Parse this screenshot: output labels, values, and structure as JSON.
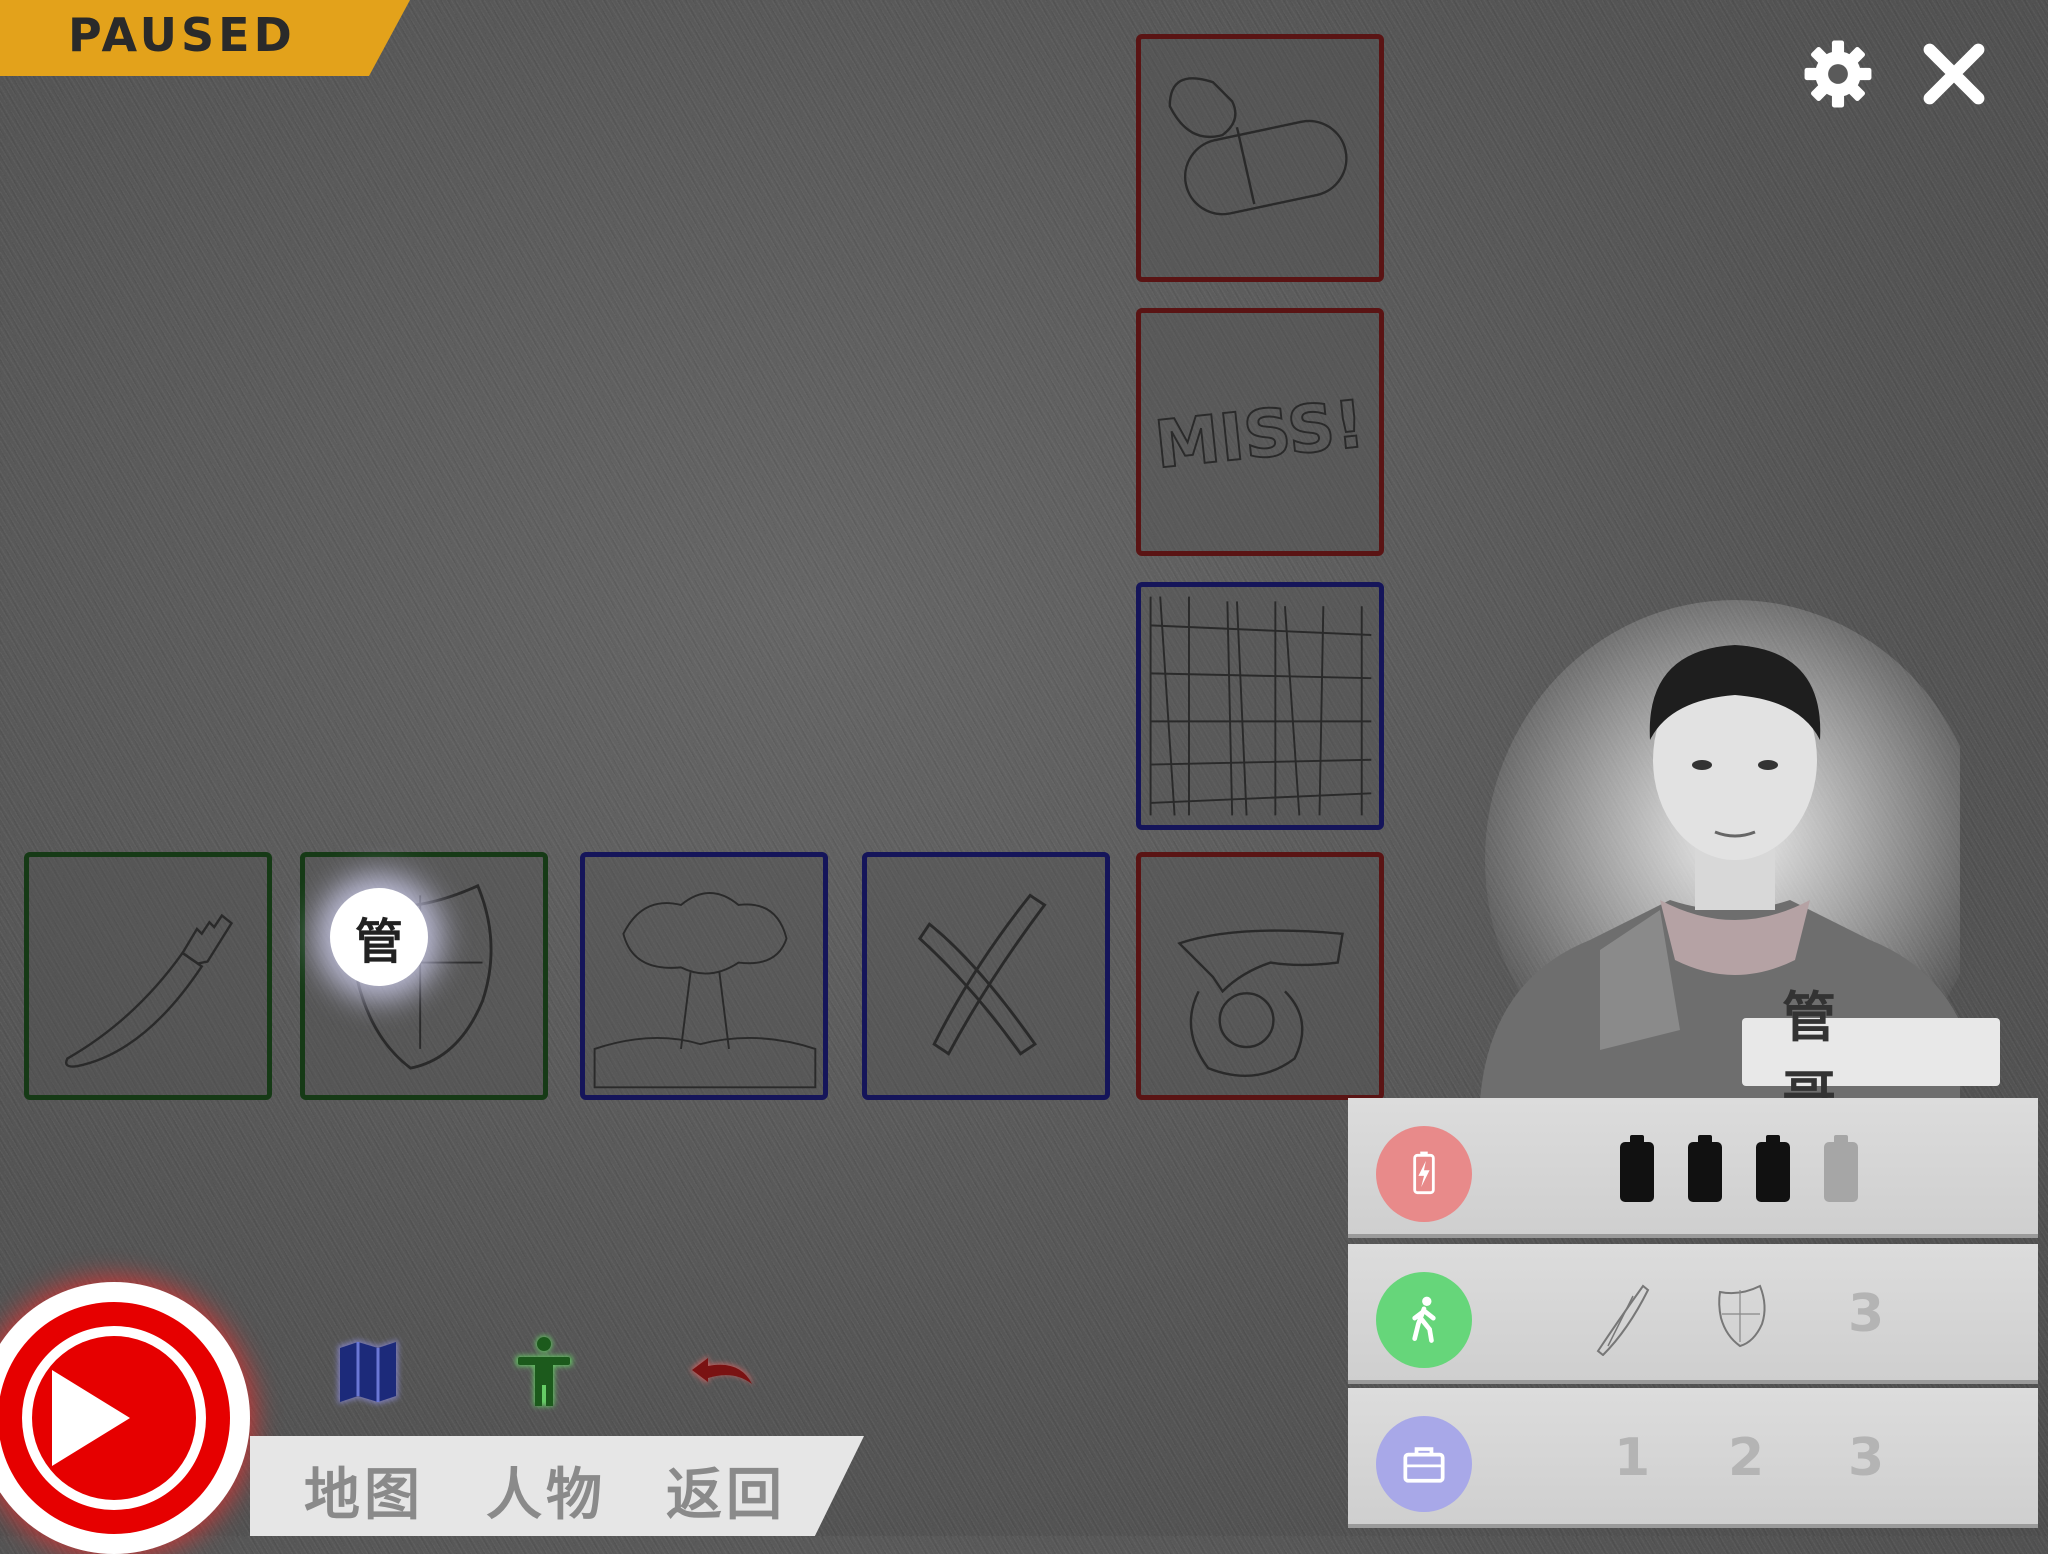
{
  "status": {
    "paused_label": "PAUSED"
  },
  "toolbar": {
    "settings_icon": "gear-icon",
    "close_icon": "close-icon"
  },
  "board": {
    "tiles": [
      {
        "id": "pill",
        "border": "red",
        "icon": "pill-icon"
      },
      {
        "id": "miss",
        "border": "red",
        "icon": "miss-text-icon"
      },
      {
        "id": "building",
        "border": "blue",
        "icon": "building-icon"
      },
      {
        "id": "knife",
        "border": "green",
        "icon": "knife-icon"
      },
      {
        "id": "shield",
        "border": "green",
        "icon": "shield-icon"
      },
      {
        "id": "explosion",
        "border": "blue",
        "icon": "explosion-icon"
      },
      {
        "id": "cross",
        "border": "blue",
        "icon": "x-mark-icon"
      },
      {
        "id": "gun",
        "border": "red",
        "icon": "gun-icon"
      }
    ],
    "player_marker": "管"
  },
  "character": {
    "name": "管 哥",
    "energy": {
      "icon": "battery-bolt-icon",
      "current": 3,
      "max": 4
    },
    "movement": {
      "icon": "walking-person-icon",
      "slot3": "3"
    },
    "inventory": {
      "icon": "briefcase-icon",
      "slots": [
        "1",
        "2",
        "3"
      ]
    }
  },
  "bottom_menu": {
    "play_icon": "play-icon",
    "map_label": "地图",
    "character_label": "人物",
    "back_label": "返回"
  },
  "colors": {
    "banner": "#e3a21b",
    "play": "#e60000",
    "energy": "#e88a8a",
    "movement": "#66d67a",
    "inventory": "#a8a8e8"
  }
}
